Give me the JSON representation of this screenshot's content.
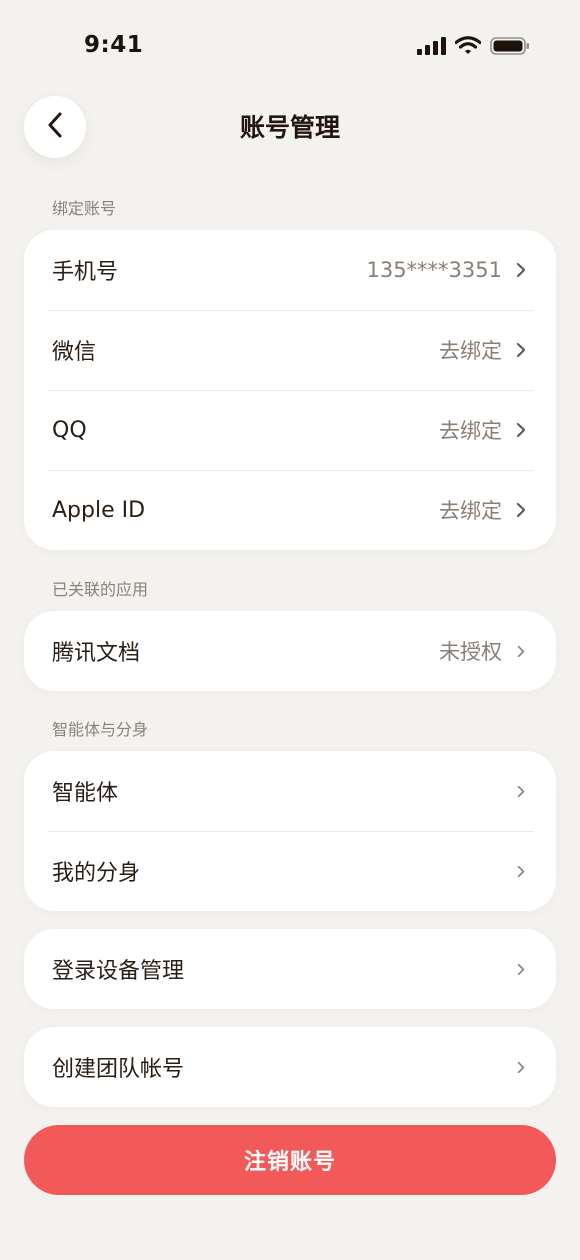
{
  "status_bar": {
    "time": "9:41"
  },
  "header": {
    "title": "账号管理"
  },
  "sections": {
    "bound_accounts": {
      "label": "绑定账号",
      "rows": [
        {
          "label": "手机号",
          "value": "135****3351"
        },
        {
          "label": "微信",
          "value": "去绑定"
        },
        {
          "label": "QQ",
          "value": "去绑定"
        },
        {
          "label": "Apple ID",
          "value": "去绑定"
        }
      ]
    },
    "linked_apps": {
      "label": "已关联的应用",
      "rows": [
        {
          "label": "腾讯文档",
          "value": "未授权"
        }
      ]
    },
    "agents": {
      "label": "智能体与分身",
      "rows": [
        {
          "label": "智能体"
        },
        {
          "label": "我的分身"
        }
      ]
    }
  },
  "devices": {
    "label": "登录设备管理"
  },
  "team": {
    "label": "创建团队帐号"
  },
  "logout": {
    "label": "注销账号"
  },
  "colors": {
    "accent": "#f25a5a",
    "background": "#f4f2ef",
    "card": "#ffffff"
  }
}
